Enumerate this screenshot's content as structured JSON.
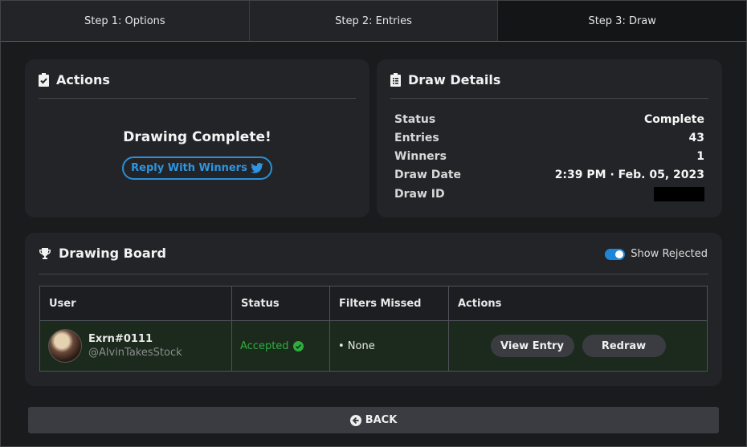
{
  "steps": [
    {
      "label": "Step 1: Options"
    },
    {
      "label": "Step 2: Entries"
    },
    {
      "label": "Step 3: Draw"
    }
  ],
  "actions": {
    "title": "Actions",
    "status_text": "Drawing Complete!",
    "reply_button": "Reply With Winners"
  },
  "details": {
    "title": "Draw Details",
    "rows": [
      {
        "key": "Status",
        "value": "Complete"
      },
      {
        "key": "Entries",
        "value": "43"
      },
      {
        "key": "Winners",
        "value": "1"
      },
      {
        "key": "Draw Date",
        "value": "2:39 PM · Feb. 05, 2023"
      },
      {
        "key": "Draw ID",
        "value": ""
      }
    ]
  },
  "board": {
    "title": "Drawing Board",
    "toggle_label": "Show Rejected",
    "toggle_on": true,
    "columns": [
      "User",
      "Status",
      "Filters Missed",
      "Actions"
    ],
    "rows": [
      {
        "username": "Exrn#0111",
        "handle": "@AlvinTakesStock",
        "status": "Accepted",
        "filters_missed": "• None",
        "view_button": "View Entry",
        "redraw_button": "Redraw"
      }
    ]
  },
  "back_button": "BACK",
  "colors": {
    "accent": "#2b8fd6",
    "accepted": "#2fae3f",
    "background": "#1a1b1d",
    "card": "#232427"
  }
}
